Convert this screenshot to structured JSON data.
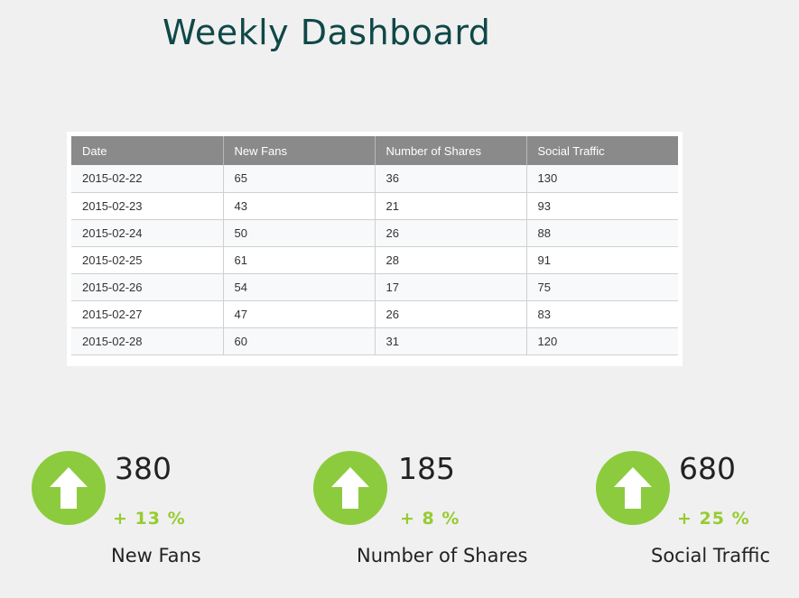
{
  "header": {
    "title": "Weekly Dashboard"
  },
  "table": {
    "columns": [
      "Date",
      "New Fans",
      "Number of Shares",
      "Social Traffic"
    ],
    "rows": [
      [
        "2015-02-22",
        "65",
        "36",
        "130"
      ],
      [
        "2015-02-23",
        "43",
        "21",
        "93"
      ],
      [
        "2015-02-24",
        "50",
        "26",
        "88"
      ],
      [
        "2015-02-25",
        "61",
        "28",
        "91"
      ],
      [
        "2015-02-26",
        "54",
        "17",
        "75"
      ],
      [
        "2015-02-27",
        "47",
        "26",
        "83"
      ],
      [
        "2015-02-28",
        "60",
        "31",
        "120"
      ]
    ]
  },
  "kpis": [
    {
      "value": "380",
      "change": "+ 13 %",
      "label": "New Fans",
      "icon": "arrow-up-icon"
    },
    {
      "value": "185",
      "change": "+ 8 %",
      "label": "Number of Shares",
      "icon": "arrow-up-icon"
    },
    {
      "value": "680",
      "change": "+ 25 %",
      "label": "Social Traffic",
      "icon": "arrow-up-icon"
    }
  ],
  "colors": {
    "title": "#0f4848",
    "accent_green": "#8ccb3e",
    "change_green": "#95cc2f",
    "table_header": "#8a8a8a"
  }
}
